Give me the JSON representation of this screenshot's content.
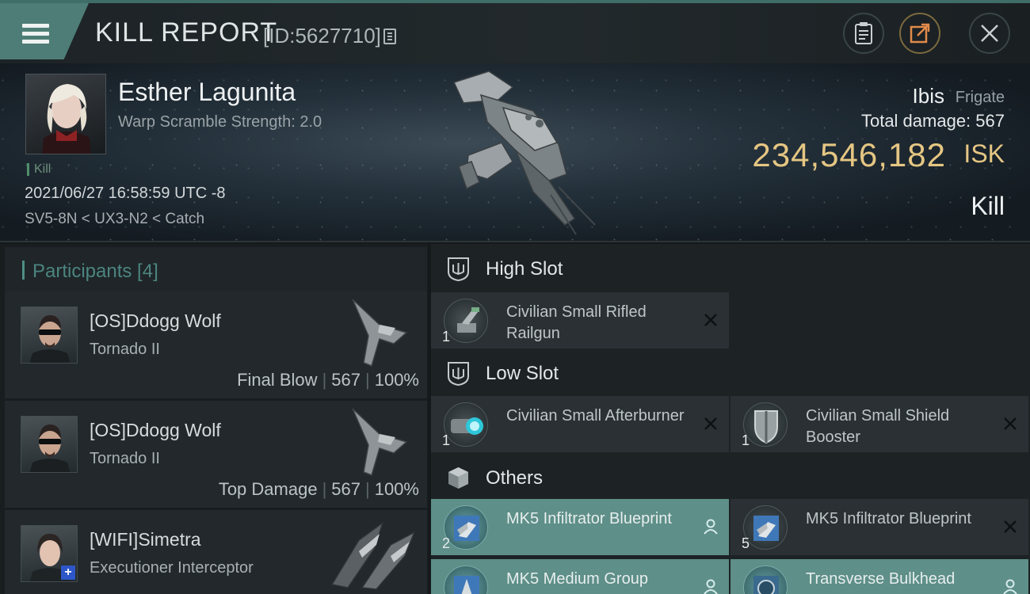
{
  "topbar": {
    "title": "KILL REPORT",
    "report_id": "[ID:5627710]"
  },
  "victim": {
    "name": "Esther Lagunita",
    "warp_scramble": "Warp Scramble Strength: 2.0",
    "kill_tag": "Kill",
    "datetime": "2021/06/27 16:58:59 UTC -8",
    "location": "SV5-8N < UX3-N2 < Catch",
    "ship_name": "Ibis",
    "ship_class": "Frigate",
    "total_damage": "Total damage:  567",
    "isk_value": "234,546,182",
    "isk_label": "ISK",
    "result": "Kill"
  },
  "participants": {
    "title": "Participants [4]",
    "rows": [
      {
        "name": "[OS]Ddogg Wolf",
        "ship": "Tornado II",
        "role": "Final Blow",
        "damage": "567",
        "percent": "100%"
      },
      {
        "name": "[OS]Ddogg Wolf",
        "ship": "Tornado II",
        "role": "Top Damage",
        "damage": "567",
        "percent": "100%"
      },
      {
        "name": "[WIFI]Simetra",
        "ship": "Executioner Interceptor",
        "role": "",
        "damage": "",
        "percent": ""
      }
    ]
  },
  "fittings": {
    "high_slot": {
      "title": "High Slot",
      "items": [
        {
          "qty": "1",
          "name": "Civilian Small Rifled Railgun",
          "status": "destroyed"
        }
      ]
    },
    "low_slot": {
      "title": "Low Slot",
      "items": [
        {
          "qty": "1",
          "name": "Civilian Small Afterburner",
          "status": "destroyed"
        },
        {
          "qty": "1",
          "name": "Civilian Small Shield Booster",
          "status": "destroyed"
        }
      ]
    },
    "others": {
      "title": "Others",
      "items": [
        {
          "qty": "2",
          "name": "MK5 Infiltrator Blueprint",
          "status": "dropped"
        },
        {
          "qty": "5",
          "name": "MK5 Infiltrator Blueprint",
          "status": "destroyed"
        },
        {
          "qty": "",
          "name": "MK5 Medium Group",
          "status": "dropped"
        },
        {
          "qty": "",
          "name": "Transverse Bulkhead",
          "status": "dropped"
        }
      ]
    }
  },
  "colors": {
    "accent": "#4e7d77",
    "isk": "#e5c683",
    "dropped_bg": "#5e8f88",
    "destroyed_bg": "#2a3033"
  },
  "icons": {
    "menu": "hamburger-icon",
    "report": "clipboard-icon",
    "share": "share-icon",
    "close": "close-icon",
    "slot": "slot-trident-icon",
    "others": "cube-icon",
    "destroyed": "x-icon",
    "dropped": "person-icon"
  }
}
